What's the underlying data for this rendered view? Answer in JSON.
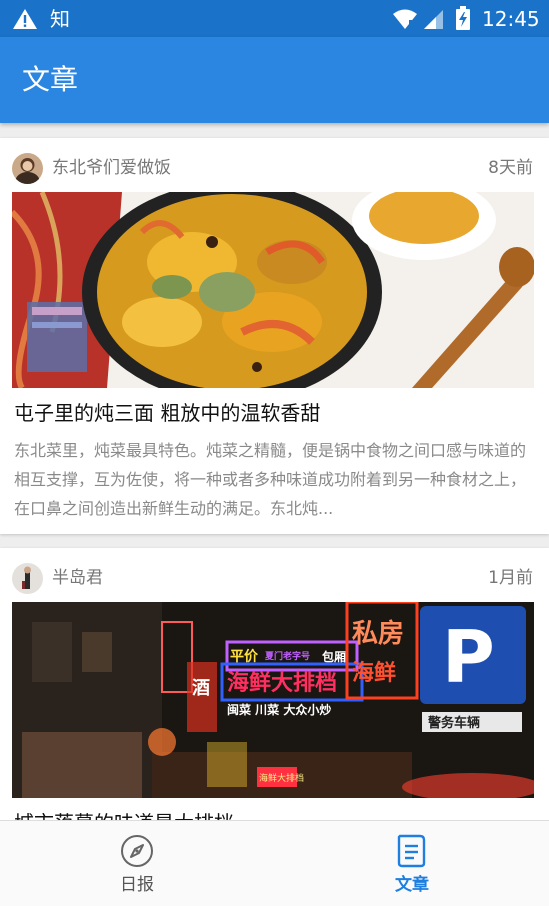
{
  "status_bar": {
    "app_char": "知",
    "time": "12:45",
    "icons": [
      "warning-icon",
      "wifi-icon",
      "signal-icon",
      "battery-icon"
    ]
  },
  "app_bar": {
    "title": "文章"
  },
  "articles": [
    {
      "author": "东北爷们爱做饭",
      "time_ago": "8天前",
      "title": "屯子里的炖三面 粗放中的温软香甜",
      "summary": "东北菜里，炖菜最具特色。炖菜之精髓，便是锅中食物之间口感与味道的相互支撑，互为佐使，将一种或者多种味道成功附着到另一种食材之上，在口鼻之间创造出新鲜生动的满足。东北炖..."
    },
    {
      "author": "半岛君",
      "time_ago": "1月前",
      "title": "城市落幕的味道是大排档",
      "signs": {
        "private_kitchen": "私房",
        "seafood": "海鲜",
        "price": "平价",
        "old_brand": "夏门老字号",
        "bao_fang": "包厢",
        "seafood_stall": "海鲜大排档",
        "menu_line": "闽菜 川菜 大众小炒",
        "liquor": "酒",
        "police": "警务车辆",
        "stall_small": "海鲜大排档",
        "parking": "P"
      }
    }
  ],
  "bottom_nav": {
    "items": [
      {
        "label": "日报",
        "icon": "compass-icon",
        "active": false
      },
      {
        "label": "文章",
        "icon": "article-icon",
        "active": true
      }
    ]
  },
  "colors": {
    "status_bar": "#1a73c8",
    "app_bar": "#2a86e0",
    "active_nav": "#1e7fe0"
  }
}
